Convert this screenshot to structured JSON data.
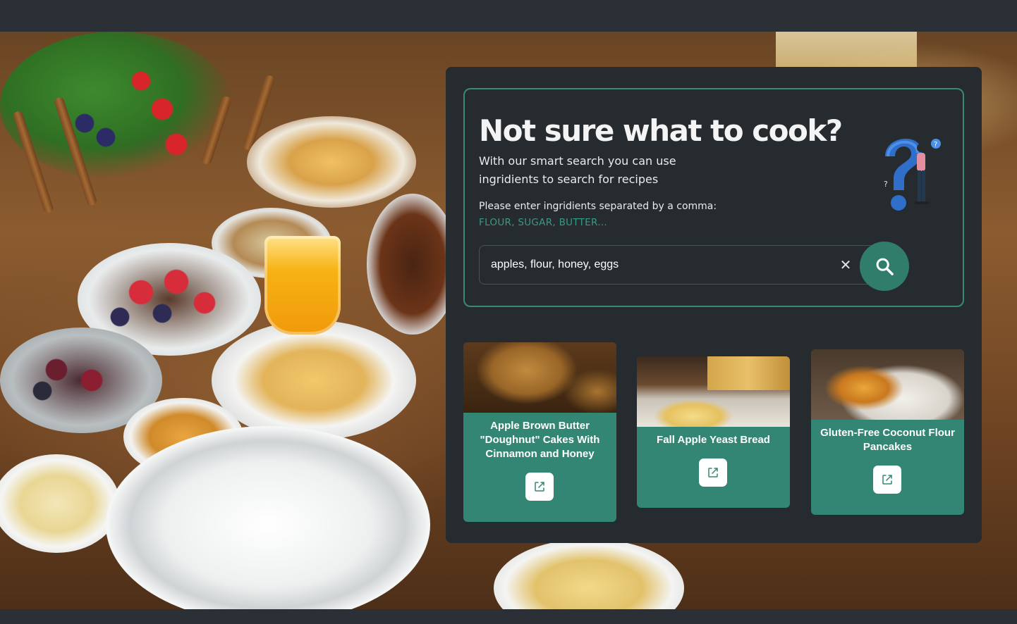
{
  "hero": {
    "headline": "Not sure what to cook?",
    "subtitle": "With our smart search you can use ingridients to search for recipes",
    "instruction": "Please enter ingridients separated by a comma:",
    "example": "FLOUR, SUGAR, BUTTER..."
  },
  "search": {
    "value": "apples, flour, honey, eggs",
    "clear_label": "✕"
  },
  "results": [
    {
      "title": "Apple Brown Butter \"Doughnut\" Cakes With Cinnamon and Honey"
    },
    {
      "title": "Fall Apple Yeast Bread"
    },
    {
      "title": "Gluten-Free Coconut Flour Pancakes"
    }
  ],
  "colors": {
    "panel": "#262b2f",
    "accent": "#338574",
    "example_text": "#3a9a82",
    "border": "#3a8a76"
  },
  "icons": {
    "search": "search-icon",
    "clear": "close-icon",
    "open": "external-link-icon",
    "illustration": "question-mark-person-illustration"
  }
}
